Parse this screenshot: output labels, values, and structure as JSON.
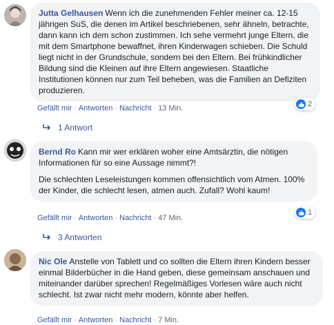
{
  "comments": [
    {
      "author": "Jutta Gelhausen",
      "paragraphs": [
        "Wenn ich die zunehmenden Fehler meiner ca. 12-15 jährigen SuS, die denen im Artikel beschriebenen, sehr ähneln, betrachte, dann kann ich dem schon zustimmen. Ich sehe vermehrt junge Eltern, die mit dem Smartphone bewaffnet, ihren Kinderwagen schieben. Die Schuld liegt nicht in der Grundschule, sondern bei den Eltern. Bei frühkindlicher Bildung sind die Kleinen auf ihre Eltern angewiesen. Staatliche Institutionen können nur zum Teil beheben, was die Familien an Defiziten produzieren."
      ],
      "reaction_count": "2",
      "like_label": "Gefällt mir",
      "reply_label": "Antworten",
      "message_label": "Nachricht",
      "time": "13 Min.",
      "replies_label": "1 Antwort"
    },
    {
      "author": "Bernd Ro",
      "paragraphs": [
        "Kann mir wer erklären woher eine Amtsärztin, die nötigen Informationen für so eine Aussage nimmt?!",
        "Die schlechten Leseleistungen kommen offensichtlich vom Atmen. 100% der Kinder, die schlecht lesen, atmen auch. Zufall? Wohl kaum!"
      ],
      "reaction_count": "1",
      "like_label": "Gefällt mir",
      "reply_label": "Antworten",
      "message_label": "Nachricht",
      "time": "47 Min.",
      "replies_label": "3 Antworten"
    },
    {
      "author": "Nic Ole",
      "paragraphs": [
        "Anstelle von Tablett und co sollten die Eltern ihren Kindern besser einmal Bilderbücher in die Hand geben, diese gemeinsam anschauen und miteinander darüber sprechen! Regelmäßiges Vorlesen wäre auch nicht schlecht. Ist zwar nicht mehr modern, könnte aber helfen."
      ],
      "like_label": "Gefällt mir",
      "reply_label": "Antworten",
      "message_label": "Nachricht",
      "time": "7 Min."
    }
  ],
  "separator": "·",
  "icons": {
    "like": "thumbs-up-icon",
    "reply_arrow": "reply-arrow-icon"
  },
  "colors": {
    "author": "#385898",
    "bubble": "#f2f3f5",
    "like_badge": "#1877f2",
    "meta": "#606770"
  }
}
